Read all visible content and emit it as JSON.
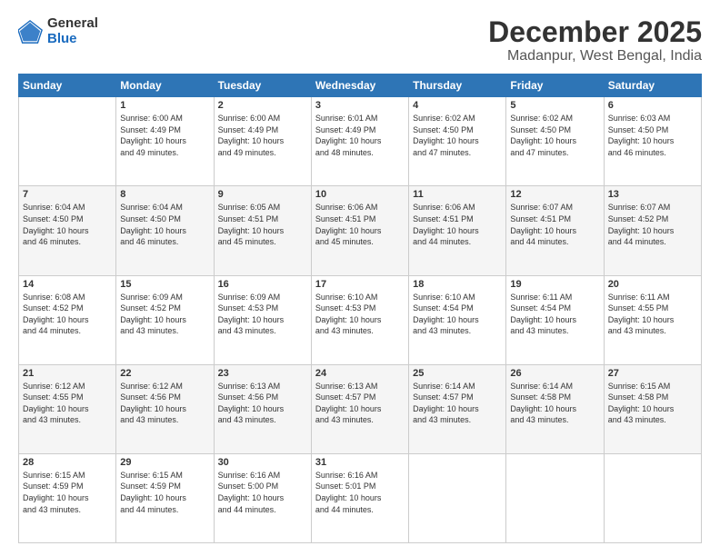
{
  "header": {
    "logo_general": "General",
    "logo_blue": "Blue",
    "title": "December 2025",
    "subtitle": "Madanpur, West Bengal, India"
  },
  "calendar": {
    "days_of_week": [
      "Sunday",
      "Monday",
      "Tuesday",
      "Wednesday",
      "Thursday",
      "Friday",
      "Saturday"
    ],
    "weeks": [
      [
        {
          "day": "",
          "info": ""
        },
        {
          "day": "1",
          "info": "Sunrise: 6:00 AM\nSunset: 4:49 PM\nDaylight: 10 hours\nand 49 minutes."
        },
        {
          "day": "2",
          "info": "Sunrise: 6:00 AM\nSunset: 4:49 PM\nDaylight: 10 hours\nand 49 minutes."
        },
        {
          "day": "3",
          "info": "Sunrise: 6:01 AM\nSunset: 4:49 PM\nDaylight: 10 hours\nand 48 minutes."
        },
        {
          "day": "4",
          "info": "Sunrise: 6:02 AM\nSunset: 4:50 PM\nDaylight: 10 hours\nand 47 minutes."
        },
        {
          "day": "5",
          "info": "Sunrise: 6:02 AM\nSunset: 4:50 PM\nDaylight: 10 hours\nand 47 minutes."
        },
        {
          "day": "6",
          "info": "Sunrise: 6:03 AM\nSunset: 4:50 PM\nDaylight: 10 hours\nand 46 minutes."
        }
      ],
      [
        {
          "day": "7",
          "info": "Sunrise: 6:04 AM\nSunset: 4:50 PM\nDaylight: 10 hours\nand 46 minutes."
        },
        {
          "day": "8",
          "info": "Sunrise: 6:04 AM\nSunset: 4:50 PM\nDaylight: 10 hours\nand 46 minutes."
        },
        {
          "day": "9",
          "info": "Sunrise: 6:05 AM\nSunset: 4:51 PM\nDaylight: 10 hours\nand 45 minutes."
        },
        {
          "day": "10",
          "info": "Sunrise: 6:06 AM\nSunset: 4:51 PM\nDaylight: 10 hours\nand 45 minutes."
        },
        {
          "day": "11",
          "info": "Sunrise: 6:06 AM\nSunset: 4:51 PM\nDaylight: 10 hours\nand 44 minutes."
        },
        {
          "day": "12",
          "info": "Sunrise: 6:07 AM\nSunset: 4:51 PM\nDaylight: 10 hours\nand 44 minutes."
        },
        {
          "day": "13",
          "info": "Sunrise: 6:07 AM\nSunset: 4:52 PM\nDaylight: 10 hours\nand 44 minutes."
        }
      ],
      [
        {
          "day": "14",
          "info": "Sunrise: 6:08 AM\nSunset: 4:52 PM\nDaylight: 10 hours\nand 44 minutes."
        },
        {
          "day": "15",
          "info": "Sunrise: 6:09 AM\nSunset: 4:52 PM\nDaylight: 10 hours\nand 43 minutes."
        },
        {
          "day": "16",
          "info": "Sunrise: 6:09 AM\nSunset: 4:53 PM\nDaylight: 10 hours\nand 43 minutes."
        },
        {
          "day": "17",
          "info": "Sunrise: 6:10 AM\nSunset: 4:53 PM\nDaylight: 10 hours\nand 43 minutes."
        },
        {
          "day": "18",
          "info": "Sunrise: 6:10 AM\nSunset: 4:54 PM\nDaylight: 10 hours\nand 43 minutes."
        },
        {
          "day": "19",
          "info": "Sunrise: 6:11 AM\nSunset: 4:54 PM\nDaylight: 10 hours\nand 43 minutes."
        },
        {
          "day": "20",
          "info": "Sunrise: 6:11 AM\nSunset: 4:55 PM\nDaylight: 10 hours\nand 43 minutes."
        }
      ],
      [
        {
          "day": "21",
          "info": "Sunrise: 6:12 AM\nSunset: 4:55 PM\nDaylight: 10 hours\nand 43 minutes."
        },
        {
          "day": "22",
          "info": "Sunrise: 6:12 AM\nSunset: 4:56 PM\nDaylight: 10 hours\nand 43 minutes."
        },
        {
          "day": "23",
          "info": "Sunrise: 6:13 AM\nSunset: 4:56 PM\nDaylight: 10 hours\nand 43 minutes."
        },
        {
          "day": "24",
          "info": "Sunrise: 6:13 AM\nSunset: 4:57 PM\nDaylight: 10 hours\nand 43 minutes."
        },
        {
          "day": "25",
          "info": "Sunrise: 6:14 AM\nSunset: 4:57 PM\nDaylight: 10 hours\nand 43 minutes."
        },
        {
          "day": "26",
          "info": "Sunrise: 6:14 AM\nSunset: 4:58 PM\nDaylight: 10 hours\nand 43 minutes."
        },
        {
          "day": "27",
          "info": "Sunrise: 6:15 AM\nSunset: 4:58 PM\nDaylight: 10 hours\nand 43 minutes."
        }
      ],
      [
        {
          "day": "28",
          "info": "Sunrise: 6:15 AM\nSunset: 4:59 PM\nDaylight: 10 hours\nand 43 minutes."
        },
        {
          "day": "29",
          "info": "Sunrise: 6:15 AM\nSunset: 4:59 PM\nDaylight: 10 hours\nand 44 minutes."
        },
        {
          "day": "30",
          "info": "Sunrise: 6:16 AM\nSunset: 5:00 PM\nDaylight: 10 hours\nand 44 minutes."
        },
        {
          "day": "31",
          "info": "Sunrise: 6:16 AM\nSunset: 5:01 PM\nDaylight: 10 hours\nand 44 minutes."
        },
        {
          "day": "",
          "info": ""
        },
        {
          "day": "",
          "info": ""
        },
        {
          "day": "",
          "info": ""
        }
      ]
    ]
  }
}
